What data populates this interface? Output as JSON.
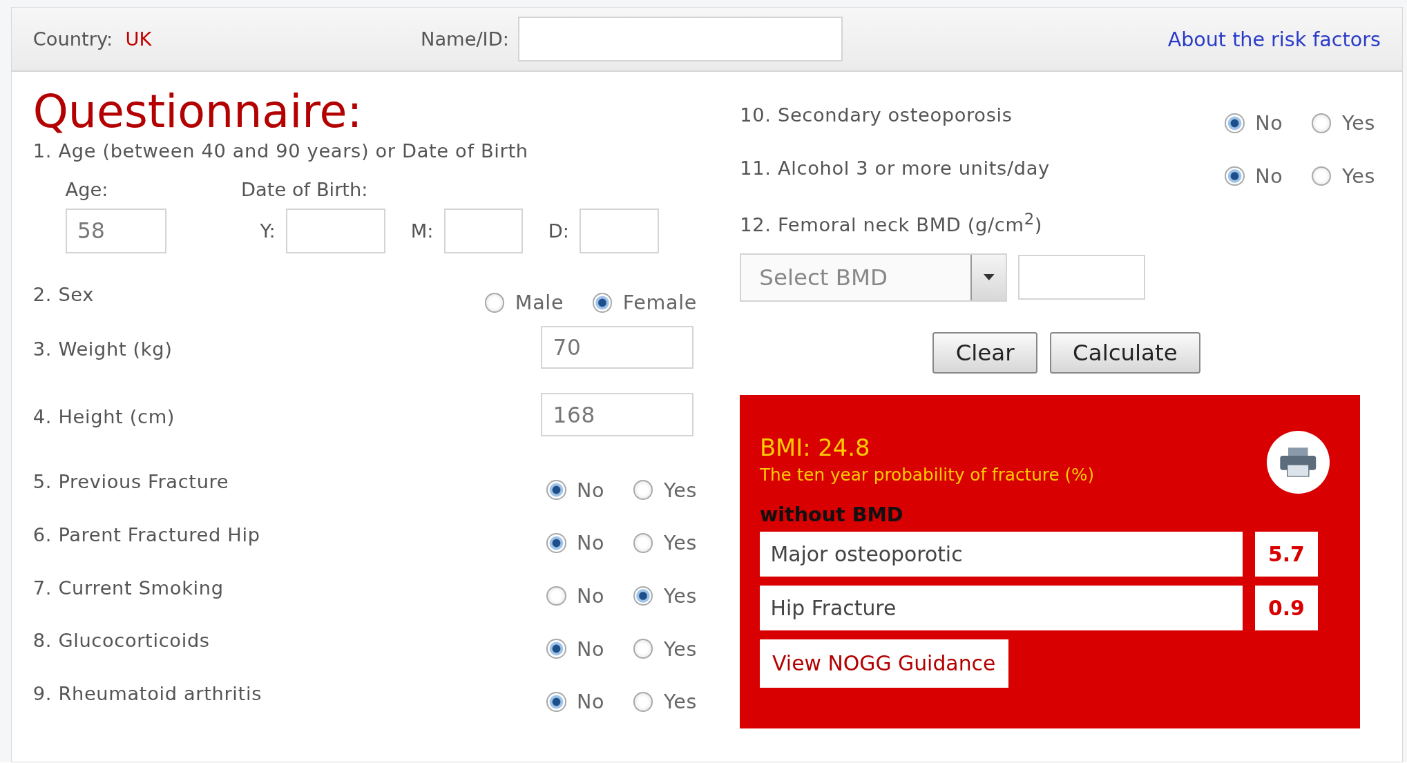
{
  "header": {
    "country_label": "Country:",
    "country": "UK",
    "name_label": "Name/ID:",
    "about_link": "About the risk factors"
  },
  "title": "Questionnaire:",
  "left_questions": [
    {
      "kind": "age",
      "label": "1. Age (between 40 and 90 years) or Date of Birth",
      "age_label": "Age:",
      "age_value": "58",
      "dob_label": "Date of Birth:",
      "dob_fields": [
        {
          "label": "Y:"
        },
        {
          "label": "M:"
        },
        {
          "label": "D:"
        }
      ]
    },
    {
      "kind": "radio",
      "label": "2. Sex",
      "options": [
        {
          "label": "Male",
          "selected": false
        },
        {
          "label": "Female",
          "selected": true
        }
      ]
    },
    {
      "kind": "input",
      "label": "3. Weight (kg)",
      "value": "70"
    },
    {
      "kind": "input",
      "label": "4. Height (cm)",
      "value": "168"
    },
    {
      "kind": "radio",
      "label": "5. Previous Fracture",
      "options": [
        {
          "label": "No",
          "selected": true
        },
        {
          "label": "Yes",
          "selected": false
        }
      ]
    },
    {
      "kind": "radio",
      "label": "6. Parent Fractured Hip",
      "options": [
        {
          "label": "No",
          "selected": true
        },
        {
          "label": "Yes",
          "selected": false
        }
      ]
    },
    {
      "kind": "radio",
      "label": "7. Current Smoking",
      "options": [
        {
          "label": "No",
          "selected": false
        },
        {
          "label": "Yes",
          "selected": true
        }
      ]
    },
    {
      "kind": "radio",
      "label": "8. Glucocorticoids",
      "options": [
        {
          "label": "No",
          "selected": true
        },
        {
          "label": "Yes",
          "selected": false
        }
      ]
    },
    {
      "kind": "radio",
      "label": "9. Rheumatoid arthritis",
      "options": [
        {
          "label": "No",
          "selected": true
        },
        {
          "label": "Yes",
          "selected": false
        }
      ]
    }
  ],
  "right_questions": [
    {
      "kind": "radio",
      "label": "10. Secondary osteoporosis",
      "options": [
        {
          "label": "No",
          "selected": true
        },
        {
          "label": "Yes",
          "selected": false
        }
      ]
    },
    {
      "kind": "radio",
      "label": "11. Alcohol 3 or more units/day",
      "options": [
        {
          "label": "No",
          "selected": true
        },
        {
          "label": "Yes",
          "selected": false
        }
      ]
    },
    {
      "kind": "bmd",
      "label": "12. Femoral neck BMD (g/cm$^{2}$)",
      "select": "Select BMD"
    }
  ],
  "buttons": [
    "Clear",
    "Calculate"
  ],
  "result": {
    "bmi": "BMI: 24.8",
    "subtitle": "The ten year probability of fracture (%)",
    "section": "without BMD",
    "rows": [
      {
        "label": "Major osteoporotic",
        "value": "5.7"
      },
      {
        "label": "Hip Fracture",
        "value": "0.9"
      }
    ],
    "guidance": "View NOGG Guidance"
  }
}
